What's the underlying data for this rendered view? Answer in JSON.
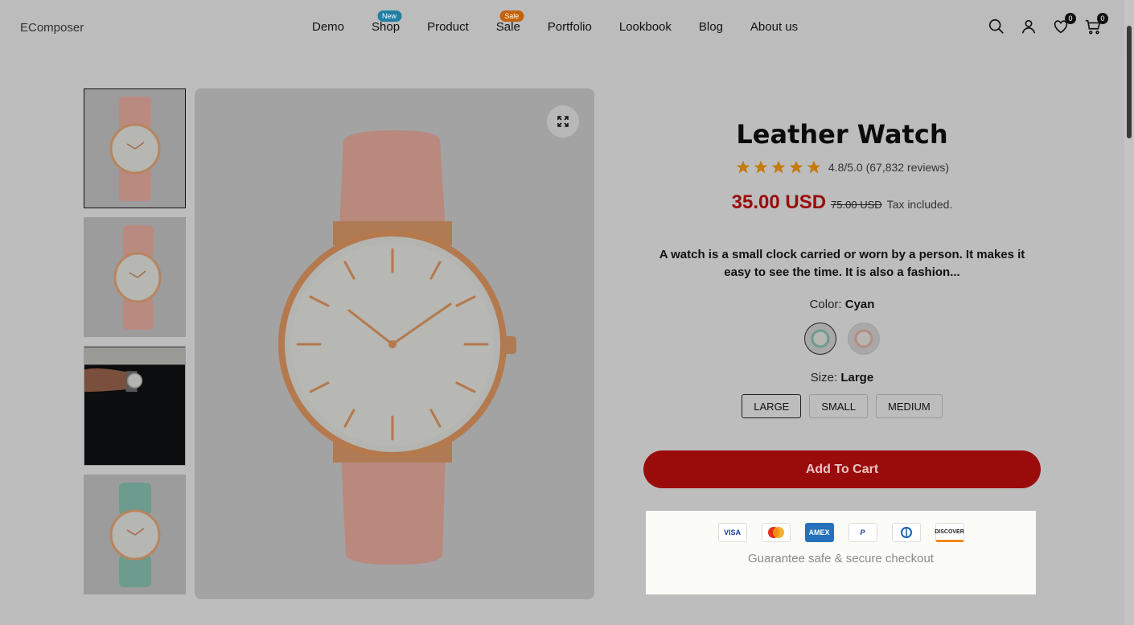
{
  "header": {
    "logo": "EComposer",
    "nav": [
      {
        "label": "Demo",
        "badge": ""
      },
      {
        "label": "Shop",
        "badge": "New"
      },
      {
        "label": "Product",
        "badge": ""
      },
      {
        "label": "Sale",
        "badge": "Sale"
      },
      {
        "label": "Portfolio",
        "badge": ""
      },
      {
        "label": "Lookbook",
        "badge": ""
      },
      {
        "label": "Blog",
        "badge": ""
      },
      {
        "label": "About us",
        "badge": ""
      }
    ],
    "wishlist_count": "0",
    "cart_count": "0",
    "icons": [
      "search-icon",
      "user-icon",
      "heart-icon",
      "cart-icon"
    ]
  },
  "gallery": {
    "thumbnails": [
      "pink-watch-front",
      "pink-watch-side",
      "watch-on-wrist",
      "cyan-watch"
    ],
    "active_index": 0,
    "zoom_icon": "expand-icon"
  },
  "product": {
    "title": "Leather Watch",
    "rating_stars": 5,
    "rating_text": "4.8/5.0 (67,832 reviews)",
    "price": "35.00 USD",
    "old_price": "75.00 USD",
    "tax_note": "Tax included.",
    "description": "A watch is a small clock carried or worn by a person. It makes it easy to see the time. It is also a fashion...",
    "color_label": "Color:",
    "color_value": "Cyan",
    "size_label": "Size:",
    "size_value": "Large",
    "sizes": [
      "LARGE",
      "SMALL",
      "MEDIUM"
    ],
    "add_to_cart": "Add To Cart",
    "secure_text": "Guarantee safe & secure checkout",
    "payment_methods": [
      "VISA",
      "MC",
      "AMEX",
      "PayPal",
      "Diners",
      "DISCOVER"
    ]
  },
  "colors": {
    "accent": "#9a0c0c",
    "badge_new": "#1f7fa3",
    "badge_sale": "#c4620c",
    "star": "#c47b0e"
  }
}
